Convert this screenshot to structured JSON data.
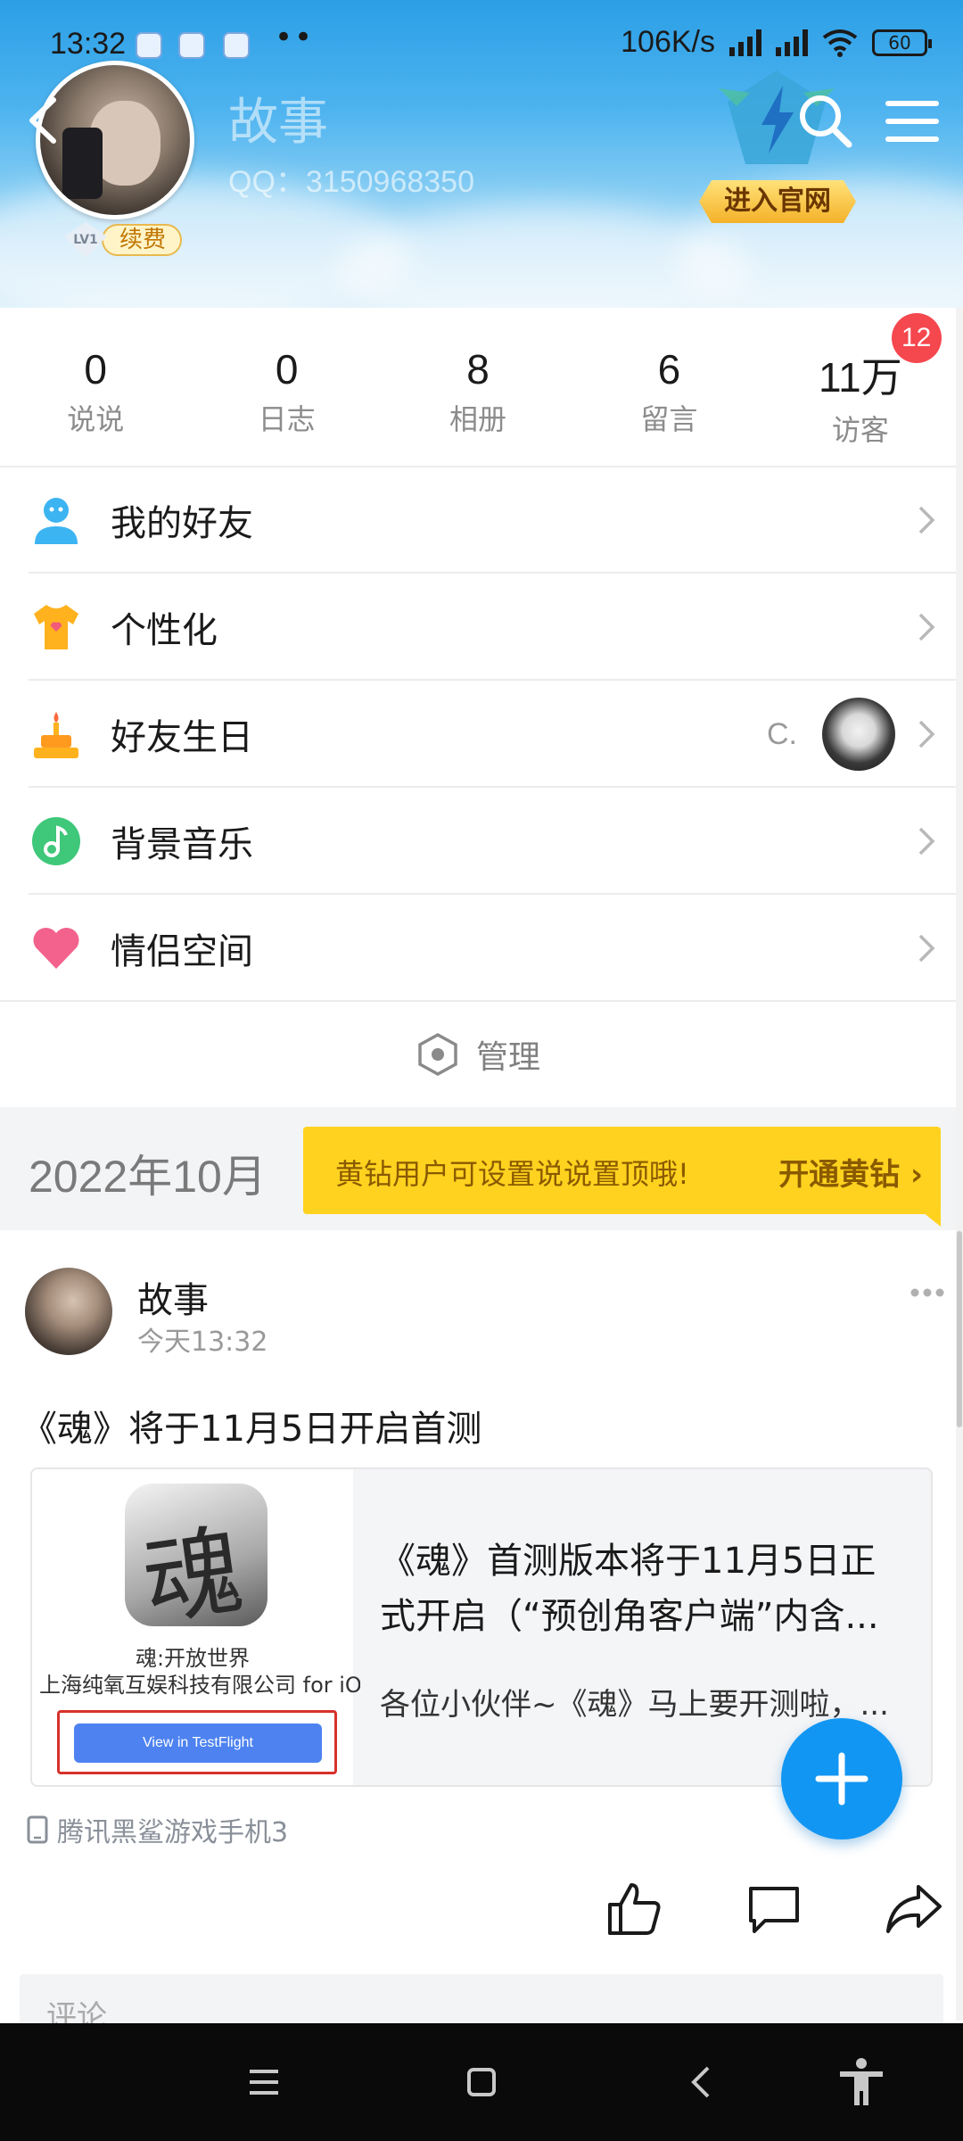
{
  "status_bar": {
    "time": "13:32",
    "dots": "••",
    "speed": "106K/s",
    "battery": "60"
  },
  "profile": {
    "name": "故事",
    "qq": "QQ：3150968350",
    "level": "LV1",
    "renew_label": "续费",
    "official_label": "进入官网"
  },
  "stats": [
    {
      "value": "0",
      "label": "说说"
    },
    {
      "value": "0",
      "label": "日志"
    },
    {
      "value": "8",
      "label": "相册"
    },
    {
      "value": "6",
      "label": "留言"
    },
    {
      "value": "11万",
      "label": "访客",
      "badge": "12"
    }
  ],
  "menu": [
    {
      "label": "我的好友",
      "icon": "friends-icon"
    },
    {
      "label": "个性化",
      "icon": "tshirt-icon"
    },
    {
      "label": "好友生日",
      "icon": "cake-icon",
      "extra": "C."
    },
    {
      "label": "背景音乐",
      "icon": "music-icon"
    },
    {
      "label": "情侣空间",
      "icon": "heart-icon"
    }
  ],
  "manage_label": "管理",
  "timeline": {
    "date": "2022年10月",
    "banner_text": "黄钻用户可设置说说置顶哦!",
    "banner_action": "开通黄钻"
  },
  "post": {
    "author": "故事",
    "time": "今天13:32",
    "text": "《魂》将于11月5日开启首测",
    "share": {
      "thumb_char": "魂",
      "game_name": "魂:开放世界",
      "company": "上海纯氧互娱科技有限公司 for iOS",
      "button": "View in TestFlight",
      "title": "《魂》首测版本将于11月5日正式开启（“预创角客户端”内含...",
      "desc": "各位小伙伴~《魂》马上要开测啦，..."
    },
    "device": "腾讯黑鲨游戏手机3",
    "comment_placeholder": "评论"
  },
  "colors": {
    "accent": "#1296f3",
    "badge_red": "#f5474e",
    "vip_yellow": "#ffd21f",
    "nav_bg": "#0a0a0a"
  }
}
